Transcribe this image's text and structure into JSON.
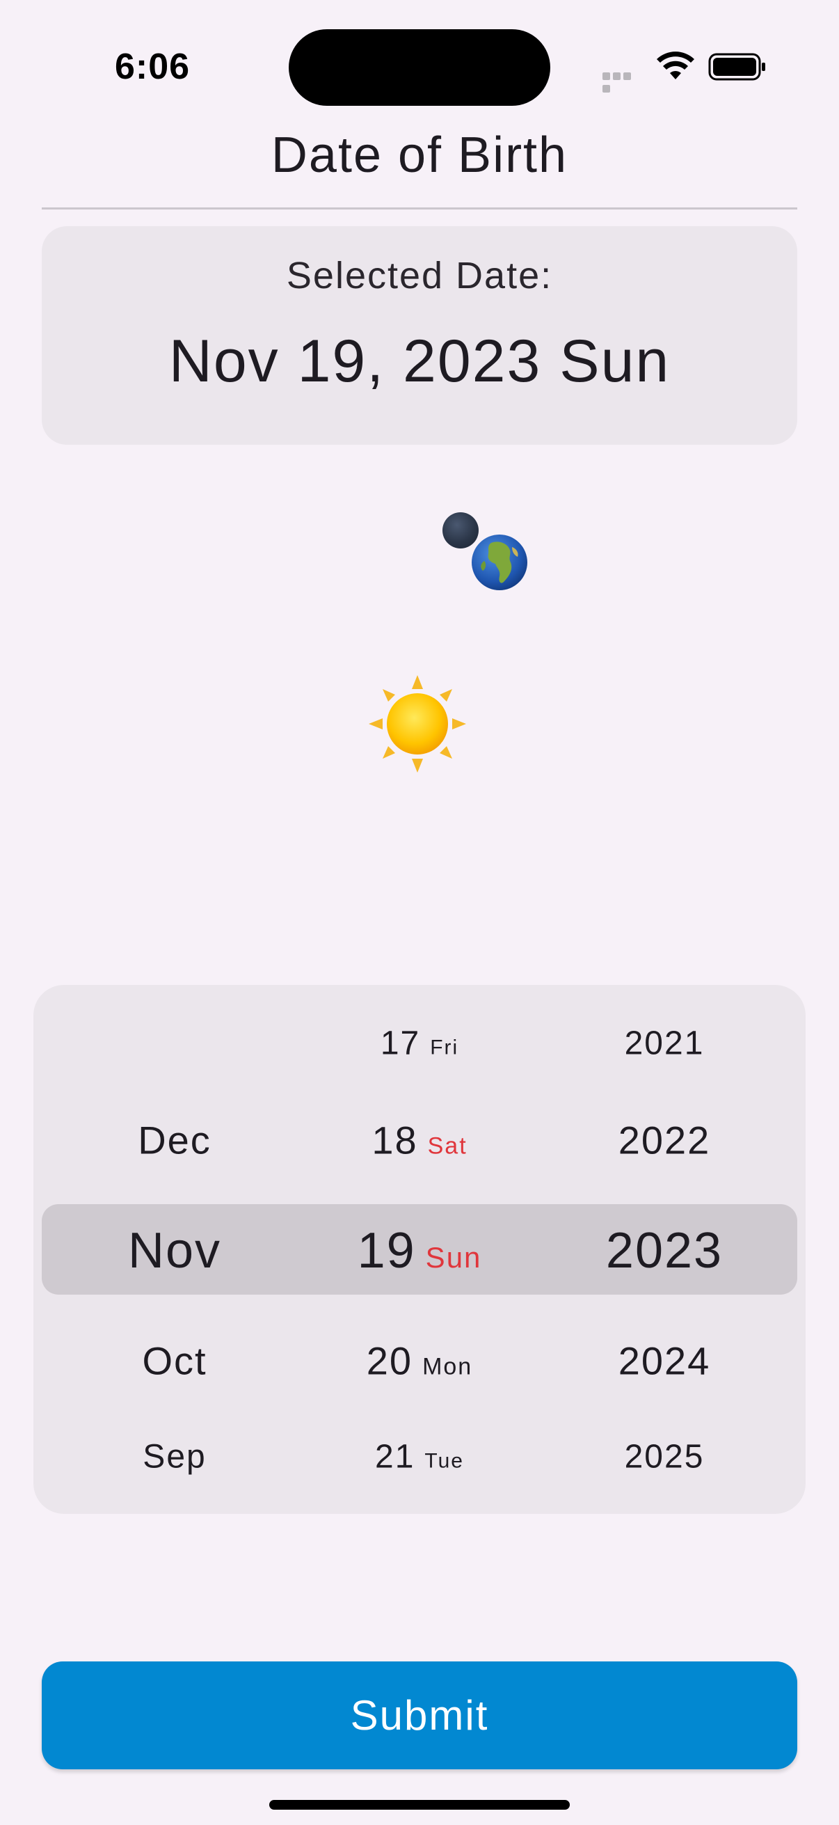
{
  "status_bar": {
    "time": "6:06",
    "icons": [
      "signal-icon",
      "wifi-icon",
      "battery-icon"
    ]
  },
  "header": {
    "title": "Date of Birth"
  },
  "selected_date": {
    "label": "Selected Date:",
    "value": "Nov 19, 2023 Sun"
  },
  "illustration": {
    "icons": [
      "moon-icon",
      "earth-icon",
      "sun-icon"
    ]
  },
  "picker": {
    "months": {
      "items": [
        "Dec",
        "Nov",
        "Oct",
        "Sep"
      ],
      "selected": "Nov"
    },
    "days": {
      "items": [
        {
          "day": "17",
          "weekday": "Fri"
        },
        {
          "day": "18",
          "weekday": "Sat"
        },
        {
          "day": "19",
          "weekday": "Sun"
        },
        {
          "day": "20",
          "weekday": "Mon"
        },
        {
          "day": "21",
          "weekday": "Tue"
        }
      ],
      "selected": "19"
    },
    "years": {
      "items": [
        "2021",
        "2022",
        "2023",
        "2024",
        "2025"
      ],
      "selected": "2023"
    },
    "weekend_color": "#e0363c",
    "highlight_color": "#cfcad0"
  },
  "submit": {
    "label": "Submit",
    "color": "#0288d1"
  }
}
